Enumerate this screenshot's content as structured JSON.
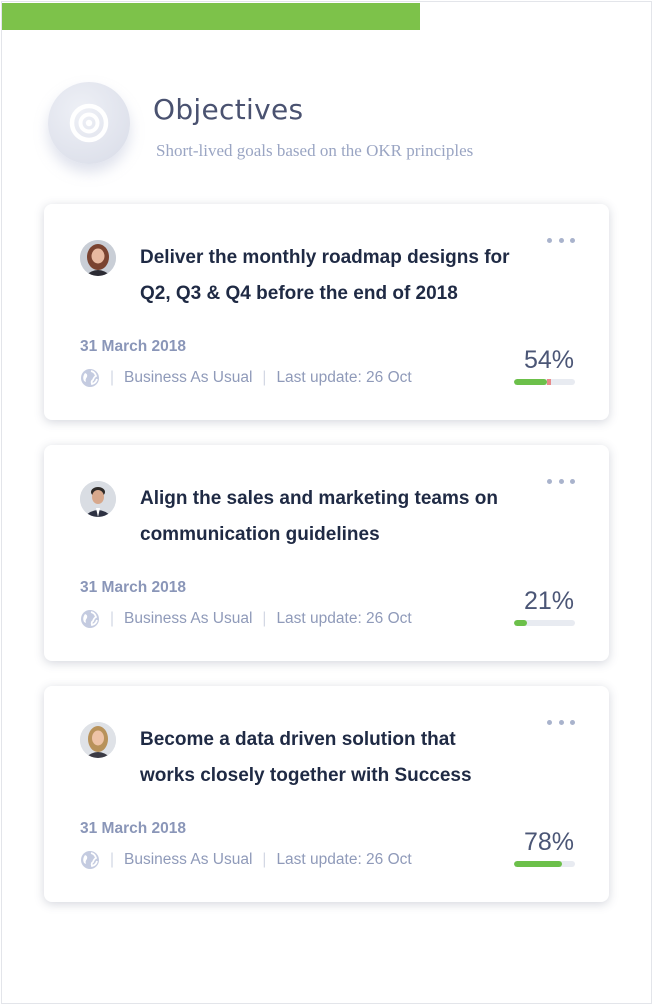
{
  "colors": {
    "accent_green": "#7dc24a",
    "progress_green": "#6cc04a",
    "progress_warning": "#e88a8a",
    "title_text": "#1f2a44",
    "muted_text": "#8f9ab9"
  },
  "header": {
    "icon": "target-icon",
    "title": "Objectives",
    "subtitle": "Short-lived goals based on the OKR principles"
  },
  "objectives": [
    {
      "title_line1": "Deliver the monthly roadmap designs for",
      "title_line2": "Q2, Q3 & Q4 before the end of 2018",
      "date": "31 March 2018",
      "visibility_icon": "globe-icon",
      "category": "Business As Usual",
      "last_update": "Last update: 26 Oct",
      "progress_label": "54%",
      "progress": 0.54,
      "avatar": "woman-redhead-avatar",
      "menu_icon": "more-dots-icon"
    },
    {
      "title_line1": "Align the sales and marketing teams on",
      "title_line2": "communication guidelines",
      "date": "31 March 2018",
      "visibility_icon": "globe-icon",
      "category": "Business As Usual",
      "last_update": "Last update: 26 Oct",
      "progress_label": "21%",
      "progress": 0.21,
      "avatar": "man-suit-avatar",
      "menu_icon": "more-dots-icon"
    },
    {
      "title_line1": "Become a data driven solution that",
      "title_line2": "works closely together with Success",
      "date": "31 March 2018",
      "visibility_icon": "globe-icon",
      "category": "Business As Usual",
      "last_update": "Last update: 26 Oct",
      "progress_label": "78%",
      "progress": 0.78,
      "avatar": "woman-blonde-avatar",
      "menu_icon": "more-dots-icon"
    }
  ]
}
